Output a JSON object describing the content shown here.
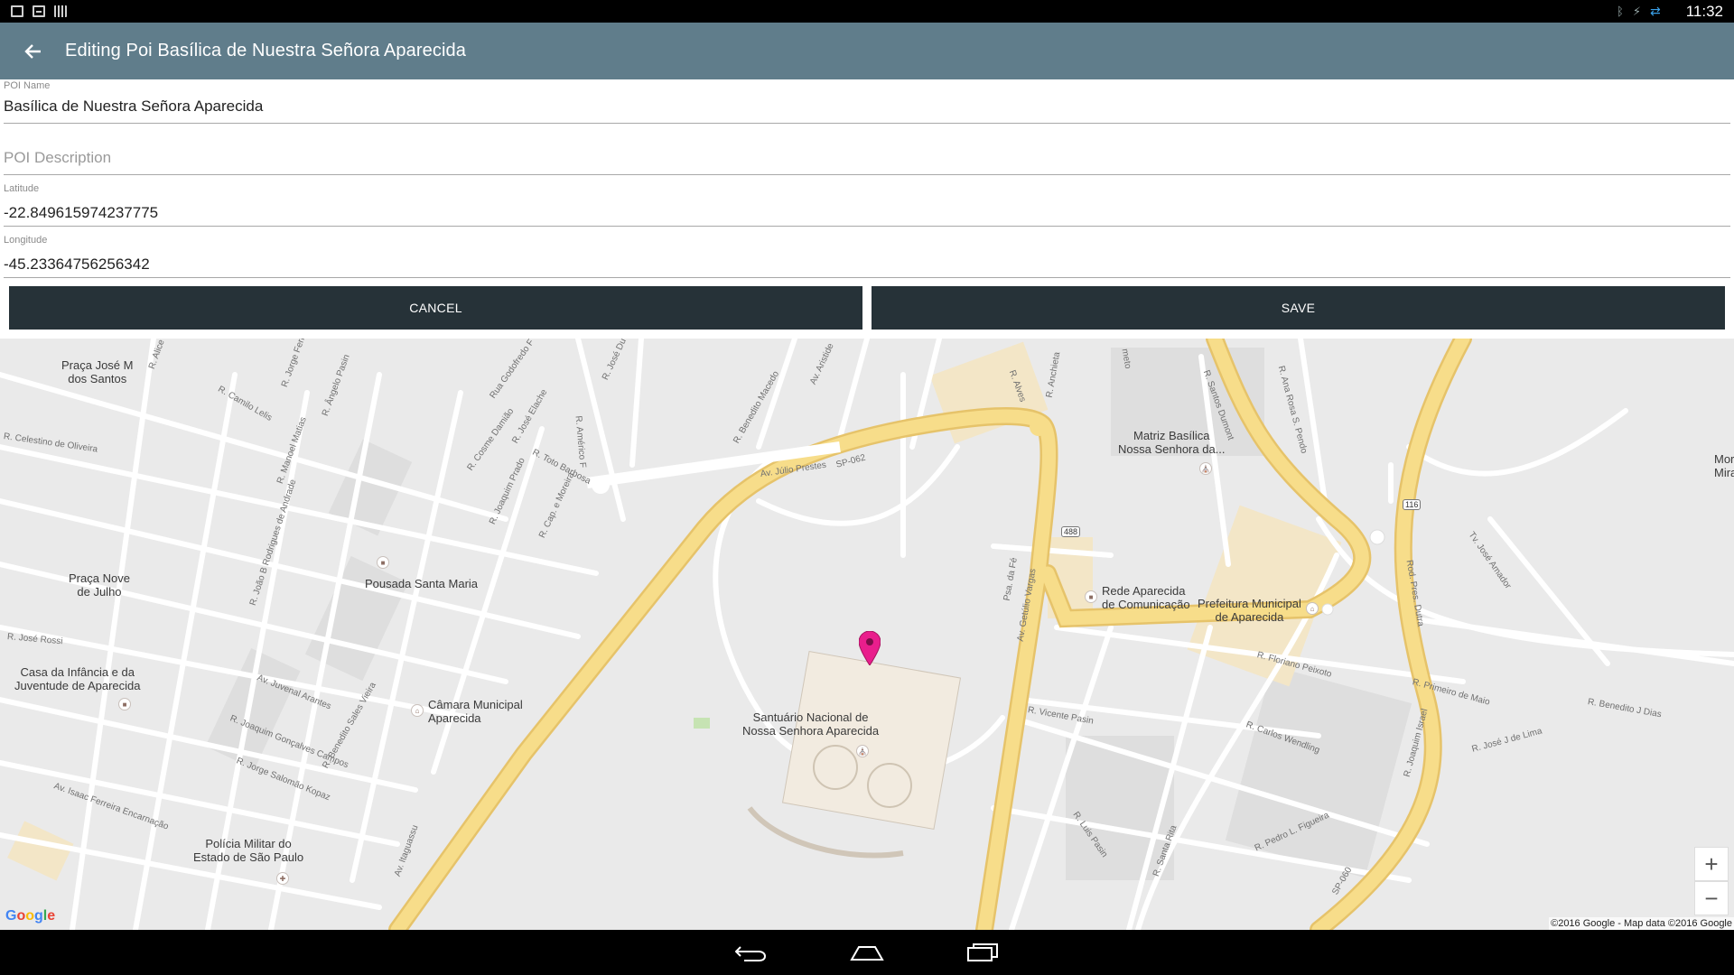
{
  "status_bar": {
    "time": "11:32",
    "icons": [
      "image-icon",
      "briefcase-icon",
      "barcode-icon",
      "bluetooth-icon",
      "signal-off-icon",
      "sync-icon"
    ]
  },
  "toolbar": {
    "title": "Editing Poi Basílica de Nuestra Señora Aparecida"
  },
  "form": {
    "poi_name": {
      "label": "POI Name",
      "value": "Basílica de Nuestra Señora Aparecida"
    },
    "poi_description": {
      "placeholder": "POI Description",
      "value": ""
    },
    "latitude": {
      "label": "Latitude",
      "value": "-22.849615974237775"
    },
    "longitude": {
      "label": "Longitude",
      "value": "-45.23364756256342"
    }
  },
  "buttons": {
    "cancel": "CANCEL",
    "save": "SAVE"
  },
  "map": {
    "places": {
      "praca_jose": "Praça José M\ndos Santos",
      "praca_nove": "Praça Nove\nde Julho",
      "pousada": "Pousada Santa Maria",
      "casa_infancia": "Casa da Infância e da\nJuventude de Aparecida",
      "camara": "Câmara Municipal\nAparecida",
      "policia": "Polícia Militar do\nEstado de São Paulo",
      "santuario": "Santuário Nacional de\nNossa Senhora Aparecida",
      "matriz": "Matriz Basílica\nNossa Senhora da...",
      "rede": "Rede Aparecida\nde Comunicação",
      "prefeitura": "Prefeitura Municipal\nde Aparecida",
      "mor": "Mor\nMira"
    },
    "streets": {
      "alice": "R. Alice S",
      "camilo": "R. Camilo Lelis",
      "jorge": "R. Jorge Ferr",
      "angelo": "R. Ângelo Pasin",
      "godofredo": "Rua Godofredo F",
      "jose_du": "R. José Du",
      "jose_elache": "R. José Elache",
      "americo": "R. Américo F",
      "benedito_macedo": "R. Benedito Macedo",
      "aristides": "Av. Aristide",
      "toto": "R. Toto Barbosa",
      "cosme": "R. Cosme Damião",
      "manoel": "R. Manoel Matias",
      "celestino": "R. Celestino de Oliveira",
      "joaquim_prado": "R. Joaquim Prado",
      "cap_moreira": "R. Cap. e Moreira",
      "joao_andrade": "R. João B Rodrigues de Andrade",
      "jose_rossi": "R. José Rossi",
      "juvenal": "Av. Juvenal Arantes",
      "joaquim_campos": "R. Joaquim Gonçalves Campos",
      "jorge_kopaz": "R. Jorge Salomão Kopaz",
      "benedito_vieira": "R. Benedito Sales Vieira",
      "isaac": "Av. Isaac Ferreira Encarnação",
      "itaguassu": "Av. Itaguassu",
      "julio_prestes": "Av. Júlio Prestes",
      "sp062": "SP-062",
      "anchieta": "R. Anchieta",
      "alves": "R. Alves",
      "psa_fe": "Psa. da Fé",
      "getulio": "Av. Getúlio Vargas",
      "santos_dumont": "R. Santos Dumont",
      "ana_rosa": "R. Ana Rosa S. Pendo",
      "jose_amador": "Tv. José Amador",
      "pres_dutra": "Rod. Pres. Dutra",
      "floriano": "R. Floriano Peixoto",
      "primeiro_maio": "R. Primeiro de Maio",
      "benedito_dias": "R. Benedito J Dias",
      "vicente": "R. Vicente Pasin",
      "carlos": "R. Carlos Wendling",
      "jose_lima": "R. José J de Lima",
      "joaquim_israel": "R. Joaquim Israel",
      "pedro": "R. Pedro L. Figueira",
      "luis": "R. Luis Pasin",
      "santa_rita": "R. Santa Rita",
      "sp060": "SP-060",
      "jardim": "meto"
    },
    "shields": {
      "r488": "488",
      "r116": "116"
    },
    "zoom_in": "+",
    "zoom_out": "−",
    "copyright": "©2016 Google - Map data ©2016 Google",
    "marker_color": "#e91e8c"
  },
  "nav": {
    "icons": [
      "back-icon",
      "home-icon",
      "recents-icon"
    ]
  },
  "colors": {
    "toolbar": "#607d8b",
    "button": "#263238",
    "road_major": "#f7dd8a"
  }
}
